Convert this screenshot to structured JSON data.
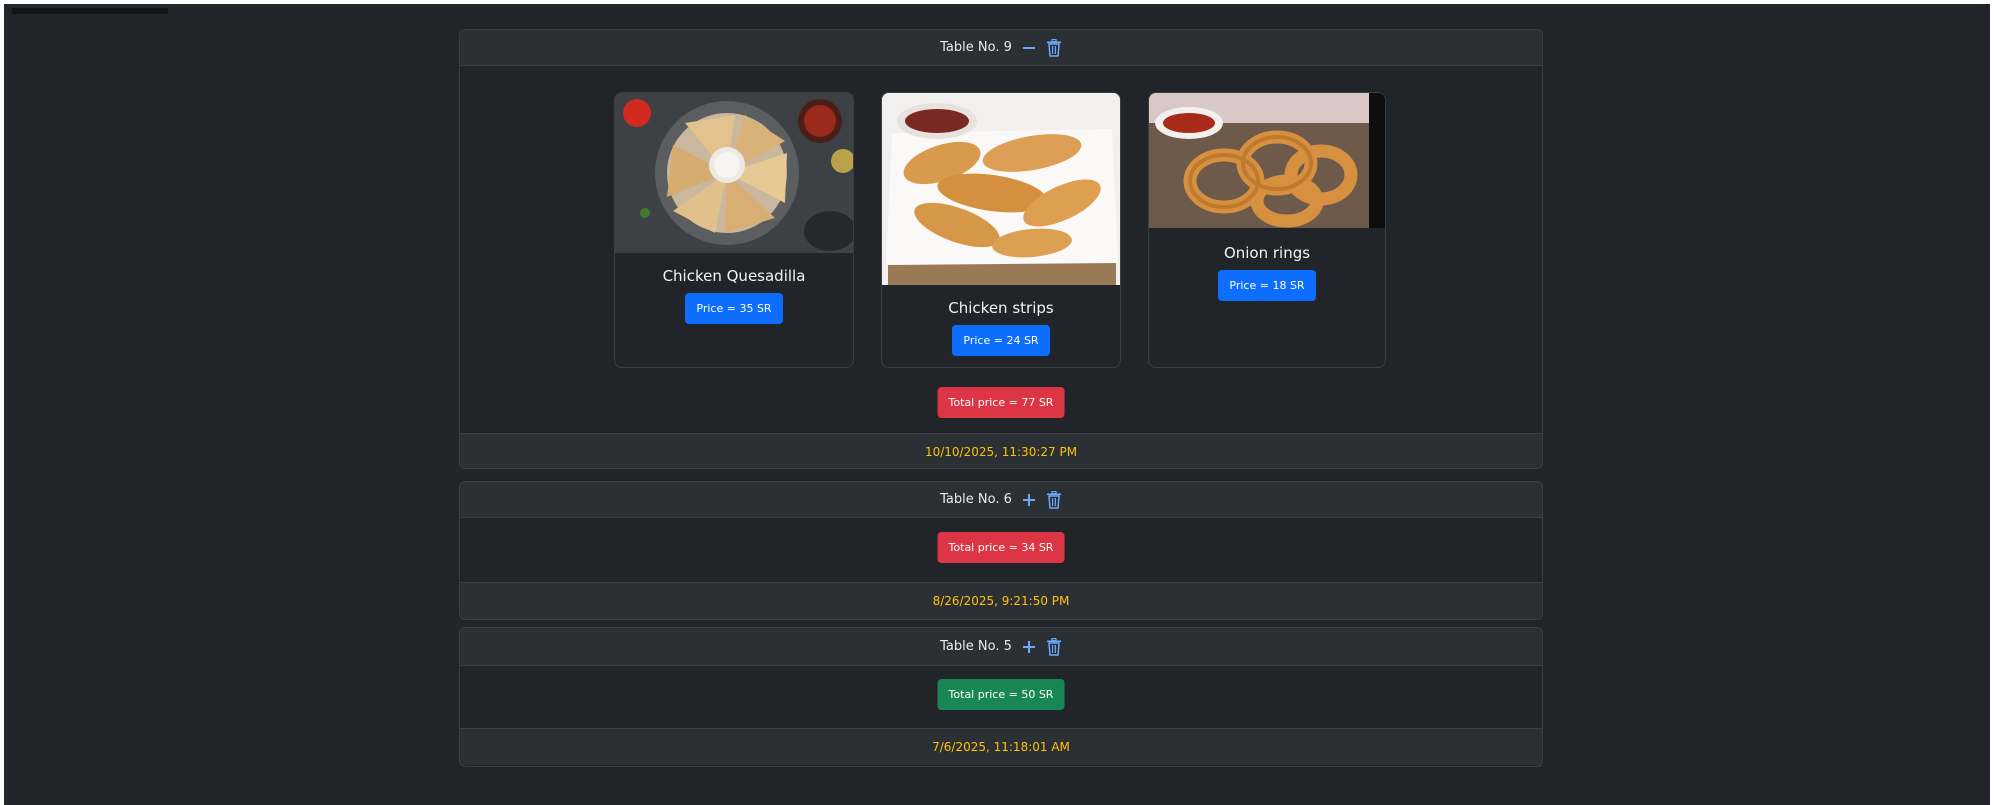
{
  "orders": [
    {
      "table": "Table No. 9",
      "toggle": "collapse",
      "items": [
        {
          "name": "Chicken Quesadilla",
          "price": "Price = 35 SR",
          "image": "quesadilla-photo"
        },
        {
          "name": "Chicken strips",
          "price": "Price = 24 SR",
          "image": "chicken-strips-photo"
        },
        {
          "name": "Onion rings",
          "price": "Price = 18 SR",
          "image": "onion-rings-photo"
        }
      ],
      "total": "Total price = 77 SR",
      "total_color": "#dc3545",
      "timestamp": "10/10/2025, 11:30:27 PM"
    },
    {
      "table": "Table No. 6",
      "toggle": "expand",
      "total": "Total price = 34 SR",
      "total_color": "#dc3545",
      "timestamp": "8/26/2025, 9:21:50 PM"
    },
    {
      "table": "Table No. 5",
      "toggle": "expand",
      "total": "Total price = 50 SR",
      "total_color": "#198754",
      "timestamp": "7/6/2025, 11:18:01 AM"
    }
  ],
  "colors": {
    "background": "#212529",
    "header": "#2b3035",
    "accent": "#0d6efd",
    "timestamp": "#ffc107",
    "unpaid": "#dc3545",
    "paid": "#198754"
  },
  "icons": [
    "minus-icon",
    "plus-icon",
    "trash-icon"
  ]
}
